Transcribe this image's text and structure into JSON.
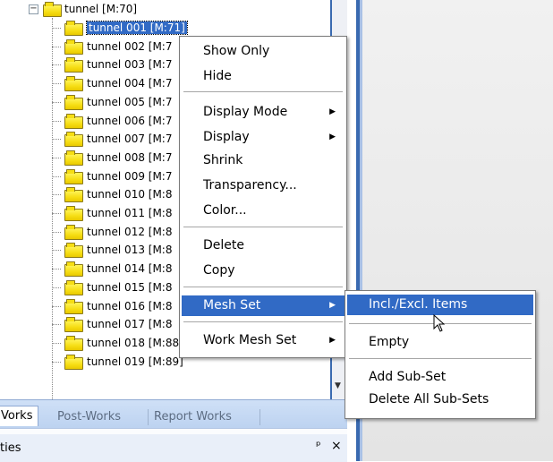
{
  "tree": {
    "root_label": "tunnel [M:70]",
    "root_expander": "−",
    "items": [
      {
        "label": "tunnel 001 [M:71]",
        "selected": true
      },
      {
        "label": "tunnel 002 [M:7"
      },
      {
        "label": "tunnel 003 [M:7"
      },
      {
        "label": "tunnel 004 [M:7"
      },
      {
        "label": "tunnel 005 [M:7"
      },
      {
        "label": "tunnel 006 [M:7"
      },
      {
        "label": "tunnel 007 [M:7"
      },
      {
        "label": "tunnel 008 [M:7"
      },
      {
        "label": "tunnel 009 [M:7"
      },
      {
        "label": "tunnel 010 [M:8"
      },
      {
        "label": "tunnel 011 [M:8"
      },
      {
        "label": "tunnel 012 [M:8"
      },
      {
        "label": "tunnel 013 [M:8"
      },
      {
        "label": "tunnel 014 [M:8"
      },
      {
        "label": "tunnel 015 [M:8"
      },
      {
        "label": "tunnel 016 [M:8"
      },
      {
        "label": "tunnel 017 [M:8"
      },
      {
        "label": "tunnel 018 [M:88]"
      },
      {
        "label": "tunnel 019 [M:89]"
      }
    ]
  },
  "tabs": {
    "items": [
      "Vorks",
      "Post-Works",
      "Report Works"
    ]
  },
  "properties": {
    "title": "ties",
    "pin_icon": "pin-icon",
    "pin_glyph": "ᵖ",
    "close_glyph": "×"
  },
  "context_menu": {
    "items": {
      "show_only": "Show Only",
      "hide": "Hide",
      "display_mode": "Display Mode",
      "display": "Display",
      "shrink": "Shrink",
      "transparency": "Transparency...",
      "color": "Color...",
      "delete": "Delete",
      "copy": "Copy",
      "mesh_set": "Mesh Set",
      "work_mesh_set": "Work Mesh Set"
    },
    "submenu_arrow": "▶"
  },
  "submenu": {
    "items": {
      "incl_excl": "Incl./Excl. Items",
      "empty": "Empty",
      "add_subset": "Add Sub-Set",
      "delete_all_subsets": "Delete All Sub-Sets"
    }
  },
  "scroll_down_glyph": "▼",
  "colors": {
    "selection": "#316ac5",
    "folder": "#f6de14",
    "tab_bar": "#cfe0f7"
  }
}
